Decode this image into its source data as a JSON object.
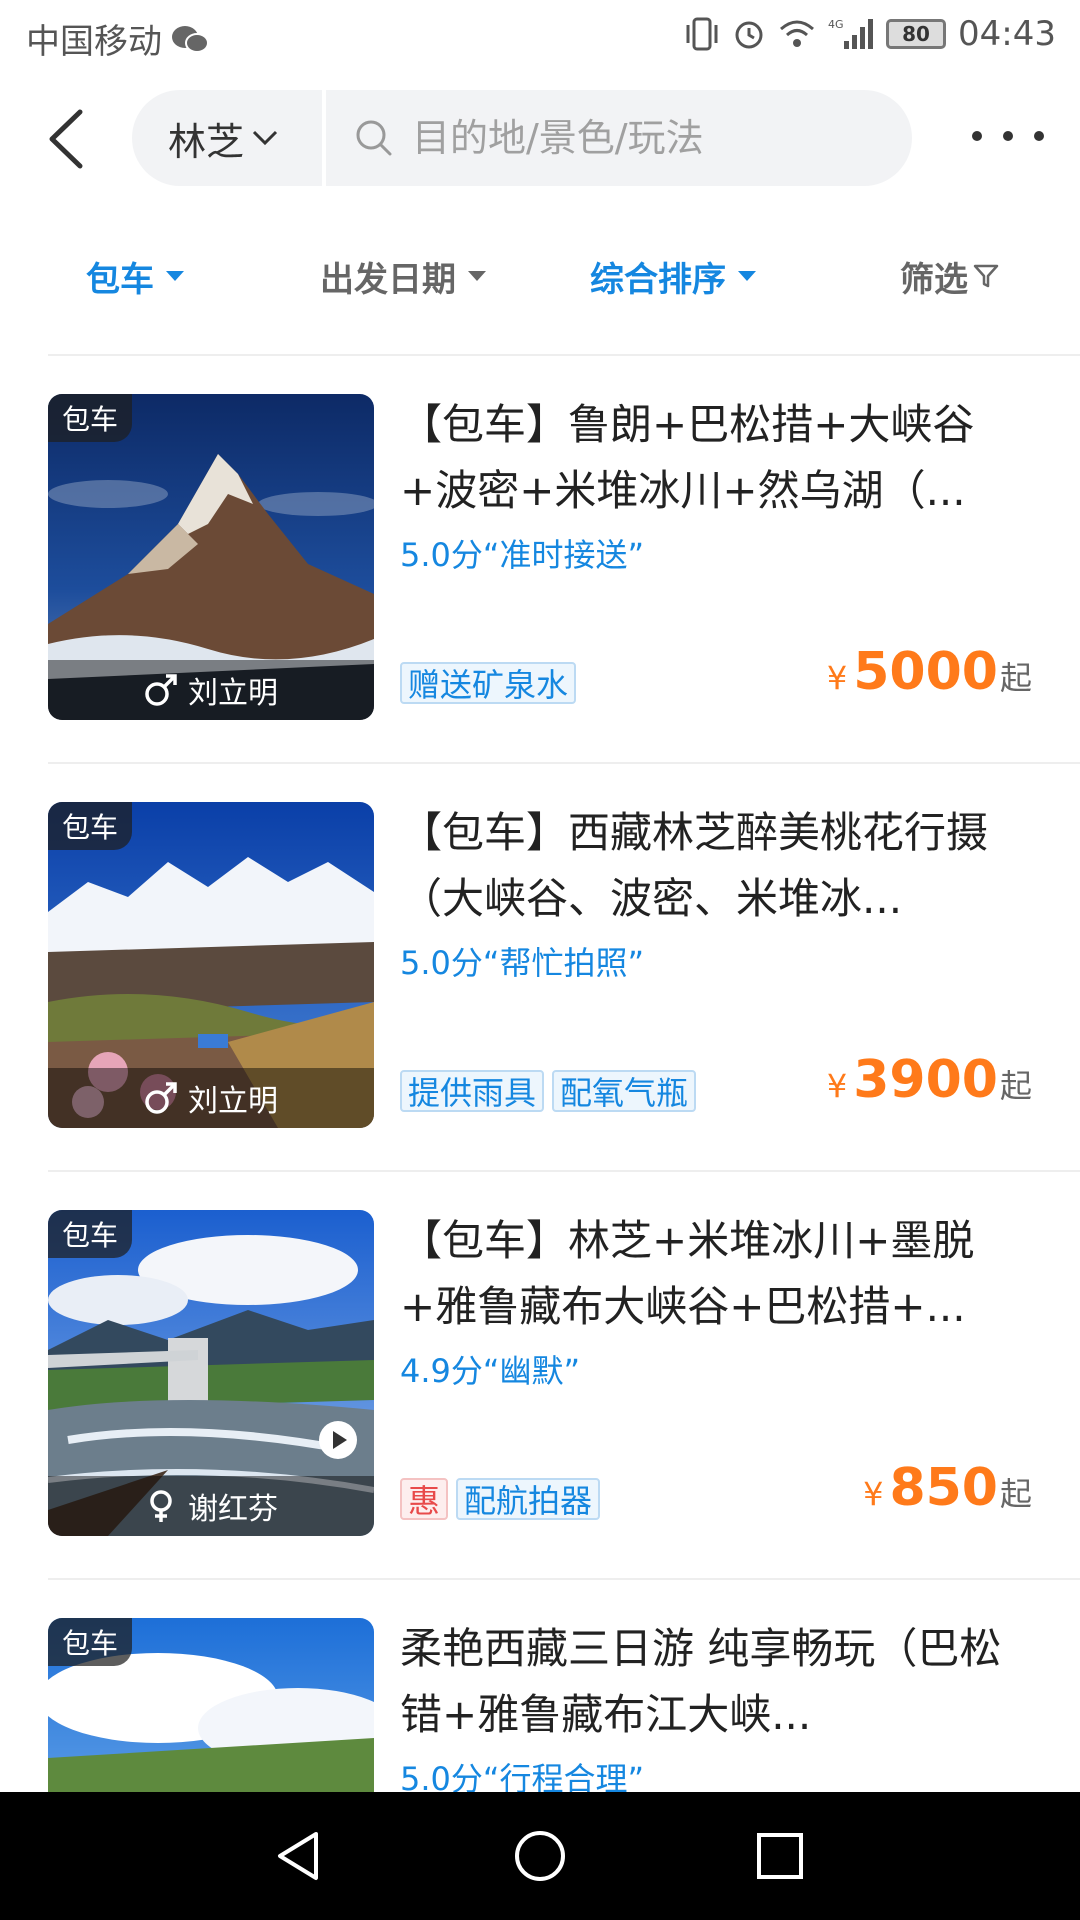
{
  "status_bar": {
    "carrier": "中国移动",
    "network": "4G",
    "battery": "80",
    "time": "04:43"
  },
  "header": {
    "city": "林芝",
    "search_placeholder": "目的地/景色/玩法"
  },
  "filters": {
    "type": "包车",
    "date": "出发日期",
    "sort": "综合排序",
    "screen": "筛选"
  },
  "listings": [
    {
      "badge": "包车",
      "driver": "刘立明",
      "driver_gender": "male-icon",
      "title": "【包车】鲁朗+巴松措+大峡谷+波密+米堆冰川+然乌湖（...",
      "rating": "5.0分“准时接送”",
      "tags": [
        "赠送矿泉水"
      ],
      "price_symbol": "¥",
      "price": "5000",
      "price_suffix": "起"
    },
    {
      "badge": "包车",
      "driver": "刘立明",
      "driver_gender": "male-icon",
      "title": "【包车】西藏林芝醉美桃花行摄（大峡谷、波密、米堆冰...",
      "rating": "5.0分“帮忙拍照”",
      "tags": [
        "提供雨具",
        "配氧气瓶"
      ],
      "price_symbol": "¥",
      "price": "3900",
      "price_suffix": "起"
    },
    {
      "badge": "包车",
      "driver": "谢红芬",
      "driver_gender": "female-icon",
      "title": "【包车】林芝+米堆冰川+墨脱+雅鲁藏布大峡谷+巴松措+...",
      "rating": "4.9分“幽默”",
      "promo_tag": "惠",
      "tags": [
        "配航拍器"
      ],
      "price_symbol": "¥",
      "price": "850",
      "price_suffix": "起"
    },
    {
      "badge": "包车",
      "title": "柔艳西藏三日游 纯享畅玩（巴松错+雅鲁藏布江大峡...",
      "rating": "5.0分“行程合理”"
    }
  ],
  "colors": {
    "accent_blue": "#1587e0",
    "price_orange": "#ff7a1a",
    "promo_red": "#e84a4a"
  }
}
